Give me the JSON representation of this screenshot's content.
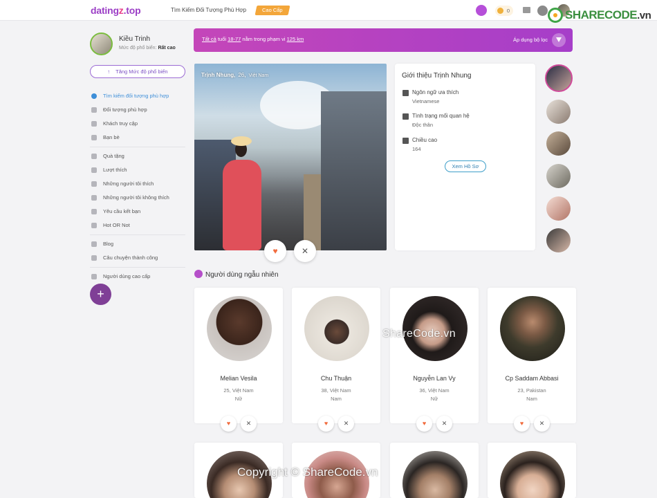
{
  "header": {
    "logo_main": "dating",
    "logo_z": "z",
    "logo_tld": ".top",
    "find_label": "Tìm Kiếm Đối Tượng Phù Hợp",
    "premium_label": "Cao Cấp",
    "coins": "0",
    "accent": "#9b3ec6",
    "premium_color": "#f3a63a"
  },
  "watermark": {
    "brand_top": "SHARECODE",
    "brand_tld": ".vn",
    "center": "ShareCode.vn",
    "bottom": "Copyright © ShareCode.vn"
  },
  "profile": {
    "name": "Kiều Trinh",
    "popularity_label": "Mức độ phổ biến:",
    "popularity_value": "Rất cao",
    "boost_button": "Tăng Mức độ phổ biến"
  },
  "menu": {
    "group1": [
      {
        "label": "Tìm kiếm đối tượng phù hợp",
        "icon": "search-people-icon",
        "active": true
      },
      {
        "label": "Đối tượng phù hợp",
        "icon": "match-icon"
      },
      {
        "label": "Khách truy cập",
        "icon": "eye-icon"
      },
      {
        "label": "Bạn bè",
        "icon": "friends-icon"
      }
    ],
    "group2": [
      {
        "label": "Quà tặng",
        "icon": "gift-icon"
      },
      {
        "label": "Lượt thích",
        "icon": "heart-icon"
      },
      {
        "label": "Những người tôi thích",
        "icon": "user-like-icon"
      },
      {
        "label": "Những người tôi không thích",
        "icon": "thumbs-down-icon"
      },
      {
        "label": "Yêu cầu kết bạn",
        "icon": "user-plus-icon"
      },
      {
        "label": "Hot OR Not",
        "icon": "fire-icon"
      }
    ],
    "group3": [
      {
        "label": "Blog",
        "icon": "blog-icon"
      },
      {
        "label": "Câu chuyện thành công",
        "icon": "book-icon"
      }
    ],
    "group4": [
      {
        "label": "Người dùng cao cấp",
        "icon": "star-icon"
      }
    ],
    "add_symbol": "+"
  },
  "filter": {
    "all": "Tất cả",
    "age_label": "tuổi",
    "age_range": "18-77",
    "radius_label": "nằm trong phạm vi",
    "radius": "125 km",
    "apply": "Áp dụng bộ lọc"
  },
  "featured": {
    "name": "Trịnh Nhung",
    "age": "26",
    "country": "Việt Nam",
    "like_symbol": "♥",
    "pass_symbol": "✕"
  },
  "about": {
    "title": "Giới thiệu Trịnh Nhung",
    "language_label": "Ngôn ngữ ưa thích",
    "language_value": "Vietnamese",
    "relationship_label": "Tình trạng mối quan hệ",
    "relationship_value": "Độc thân",
    "height_label": "Chiều cao",
    "height_value": "164",
    "view_profile": "Xem Hồ Sơ"
  },
  "random_users": {
    "title": "Người dùng ngẫu nhiên",
    "like_symbol": "♥",
    "pass_symbol": "✕",
    "cards": [
      {
        "name": "Melian Vesila",
        "location": "25, Việt Nam",
        "gender": "Nữ"
      },
      {
        "name": "Chu Thuận",
        "location": "38, Việt Nam",
        "gender": "Nam"
      },
      {
        "name": "Nguyễn Lan Vy",
        "location": "36, Việt Nam",
        "gender": "Nữ"
      },
      {
        "name": "Cp Saddam Abbasi",
        "location": "23, Pakistan",
        "gender": "Nam"
      }
    ]
  }
}
